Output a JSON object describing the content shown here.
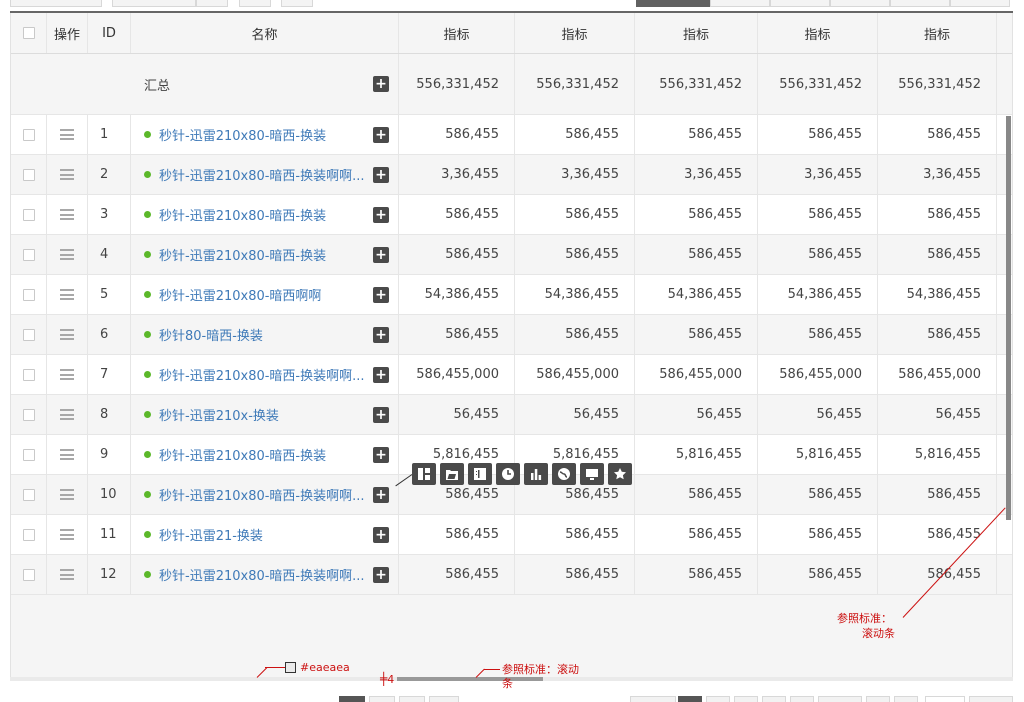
{
  "columns": {
    "action": "操作",
    "id": "ID",
    "name": "名称",
    "metrics": [
      "指标",
      "指标",
      "指标",
      "指标",
      "指标"
    ]
  },
  "summary": {
    "label": "汇总",
    "values": [
      "556,331,452",
      "556,331,452",
      "556,331,452",
      "556,331,452",
      "556,331,452"
    ]
  },
  "rows": [
    {
      "id": "1",
      "name": "秒针-迅雷210x80-暗西-换装",
      "values": [
        "586,455",
        "586,455",
        "586,455",
        "586,455",
        "586,455"
      ]
    },
    {
      "id": "2",
      "name": "秒针-迅雷210x80-暗西-换装啊啊...",
      "values": [
        "3,36,455",
        "3,36,455",
        "3,36,455",
        "3,36,455",
        "3,36,455"
      ]
    },
    {
      "id": "3",
      "name": "秒针-迅雷210x80-暗西-换装",
      "values": [
        "586,455",
        "586,455",
        "586,455",
        "586,455",
        "586,455"
      ]
    },
    {
      "id": "4",
      "name": "秒针-迅雷210x80-暗西-换装",
      "values": [
        "586,455",
        "586,455",
        "586,455",
        "586,455",
        "586,455"
      ]
    },
    {
      "id": "5",
      "name": "秒针-迅雷210x80-暗西啊啊",
      "values": [
        "54,386,455",
        "54,386,455",
        "54,386,455",
        "54,386,455",
        "54,386,455"
      ]
    },
    {
      "id": "6",
      "name": "秒针80-暗西-换装",
      "values": [
        "586,455",
        "586,455",
        "586,455",
        "586,455",
        "586,455"
      ]
    },
    {
      "id": "7",
      "name": "秒针-迅雷210x80-暗西-换装啊啊...",
      "values": [
        "586,455,000",
        "586,455,000",
        "586,455,000",
        "586,455,000",
        "586,455,000"
      ]
    },
    {
      "id": "8",
      "name": "秒针-迅雷210x-换装",
      "values": [
        "56,455",
        "56,455",
        "56,455",
        "56,455",
        "56,455"
      ]
    },
    {
      "id": "9",
      "name": "秒针-迅雷210x80-暗西-换装",
      "values": [
        "5,816,455",
        "5,816,455",
        "5,816,455",
        "5,816,455",
        "5,816,455"
      ]
    },
    {
      "id": "10",
      "name": "秒针-迅雷210x80-暗西-换装啊啊...",
      "values": [
        "586,455",
        "586,455",
        "586,455",
        "586,455",
        "586,455"
      ]
    },
    {
      "id": "11",
      "name": "秒针-迅雷21-换装",
      "values": [
        "586,455",
        "586,455",
        "586,455",
        "586,455",
        "586,455"
      ]
    },
    {
      "id": "12",
      "name": "秒针-迅雷210x80-暗西-换装啊啊...",
      "values": [
        "586,455",
        "586,455",
        "586,455",
        "586,455",
        "586,455"
      ]
    }
  ],
  "plus_glyph": "+",
  "toolbar_icons": [
    "layout-icon",
    "folder-icon",
    "columns-icon",
    "clock-icon",
    "bar-chart-icon",
    "globe-icon",
    "monitor-icon",
    "star-icon"
  ],
  "annotations": {
    "vscroll_ref_line1": "参照标准：",
    "vscroll_ref_line2": "滚动条",
    "track_color": "#eaeaea",
    "hscroll_height": "4",
    "hscroll_ref_line1": "参照标准：滚动",
    "hscroll_ref_line2": "条"
  },
  "colors": {
    "link": "#3f7ab8",
    "status_dot": "#5cb82a",
    "annotation": "#cc1111",
    "scroll_track": "#eaeaea"
  }
}
